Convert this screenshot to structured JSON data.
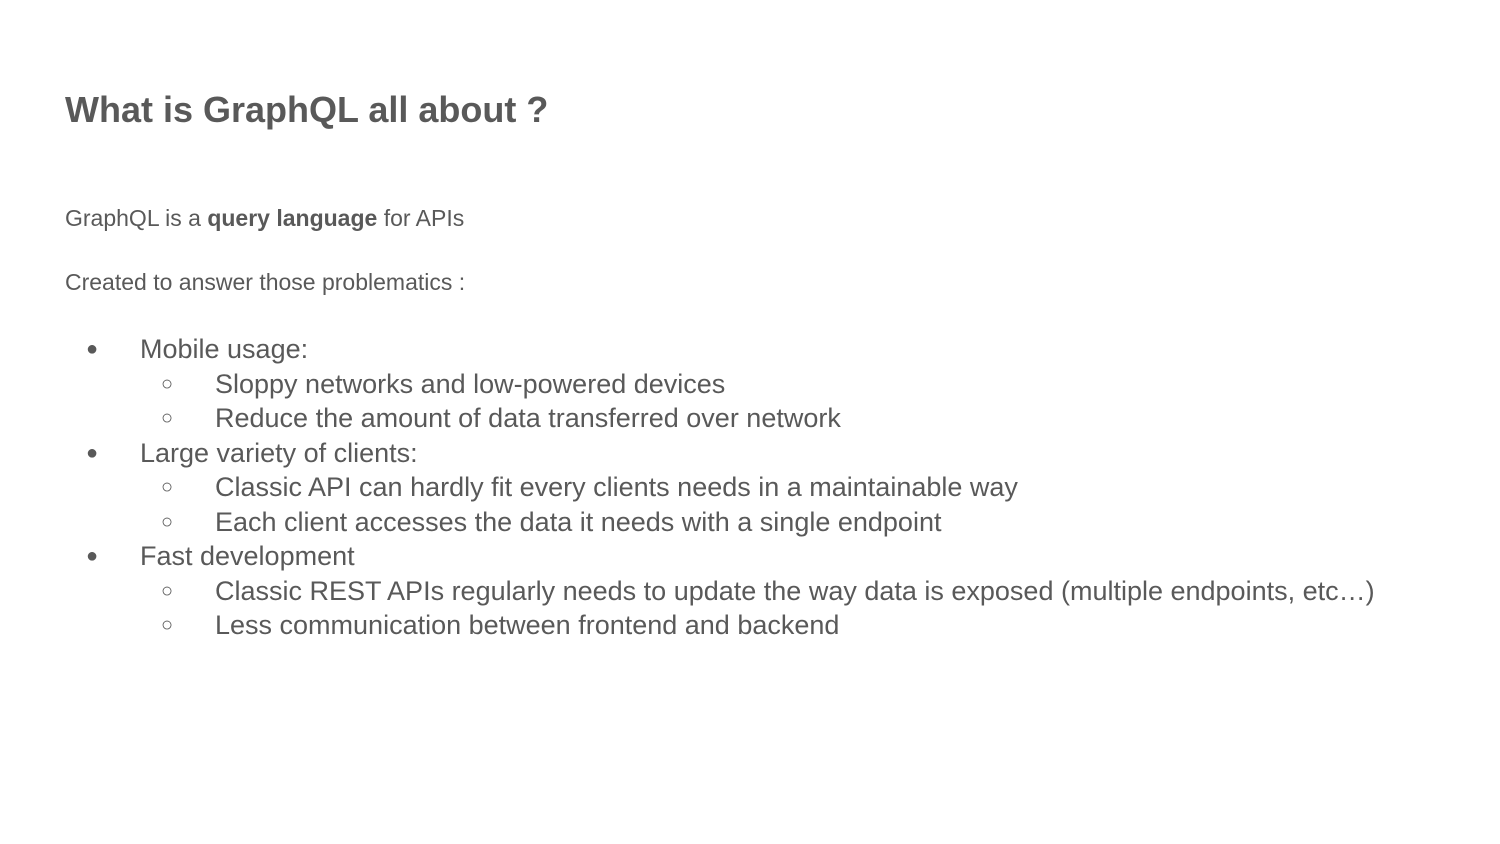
{
  "slide": {
    "title": "What is GraphQL all about ?",
    "intro": {
      "line1_prefix": "GraphQL is a ",
      "line1_bold": "query language",
      "line1_suffix": " for APIs",
      "line2": "Created to answer those problematics :"
    },
    "markers": {
      "level1": "●",
      "level2": "○"
    },
    "bullets": [
      {
        "text": "Mobile usage:",
        "children": [
          "Sloppy networks and low-powered devices",
          "Reduce the amount of data transferred over network"
        ]
      },
      {
        "text": "Large variety of clients:",
        "children": [
          "Classic API can hardly fit every clients needs in a maintainable way",
          "Each client accesses the data it needs with a single endpoint"
        ]
      },
      {
        "text": "Fast development",
        "children": [
          "Classic REST APIs regularly needs to update the way data is exposed (multiple endpoints, etc…)",
          "Less communication between frontend and backend"
        ]
      }
    ]
  }
}
